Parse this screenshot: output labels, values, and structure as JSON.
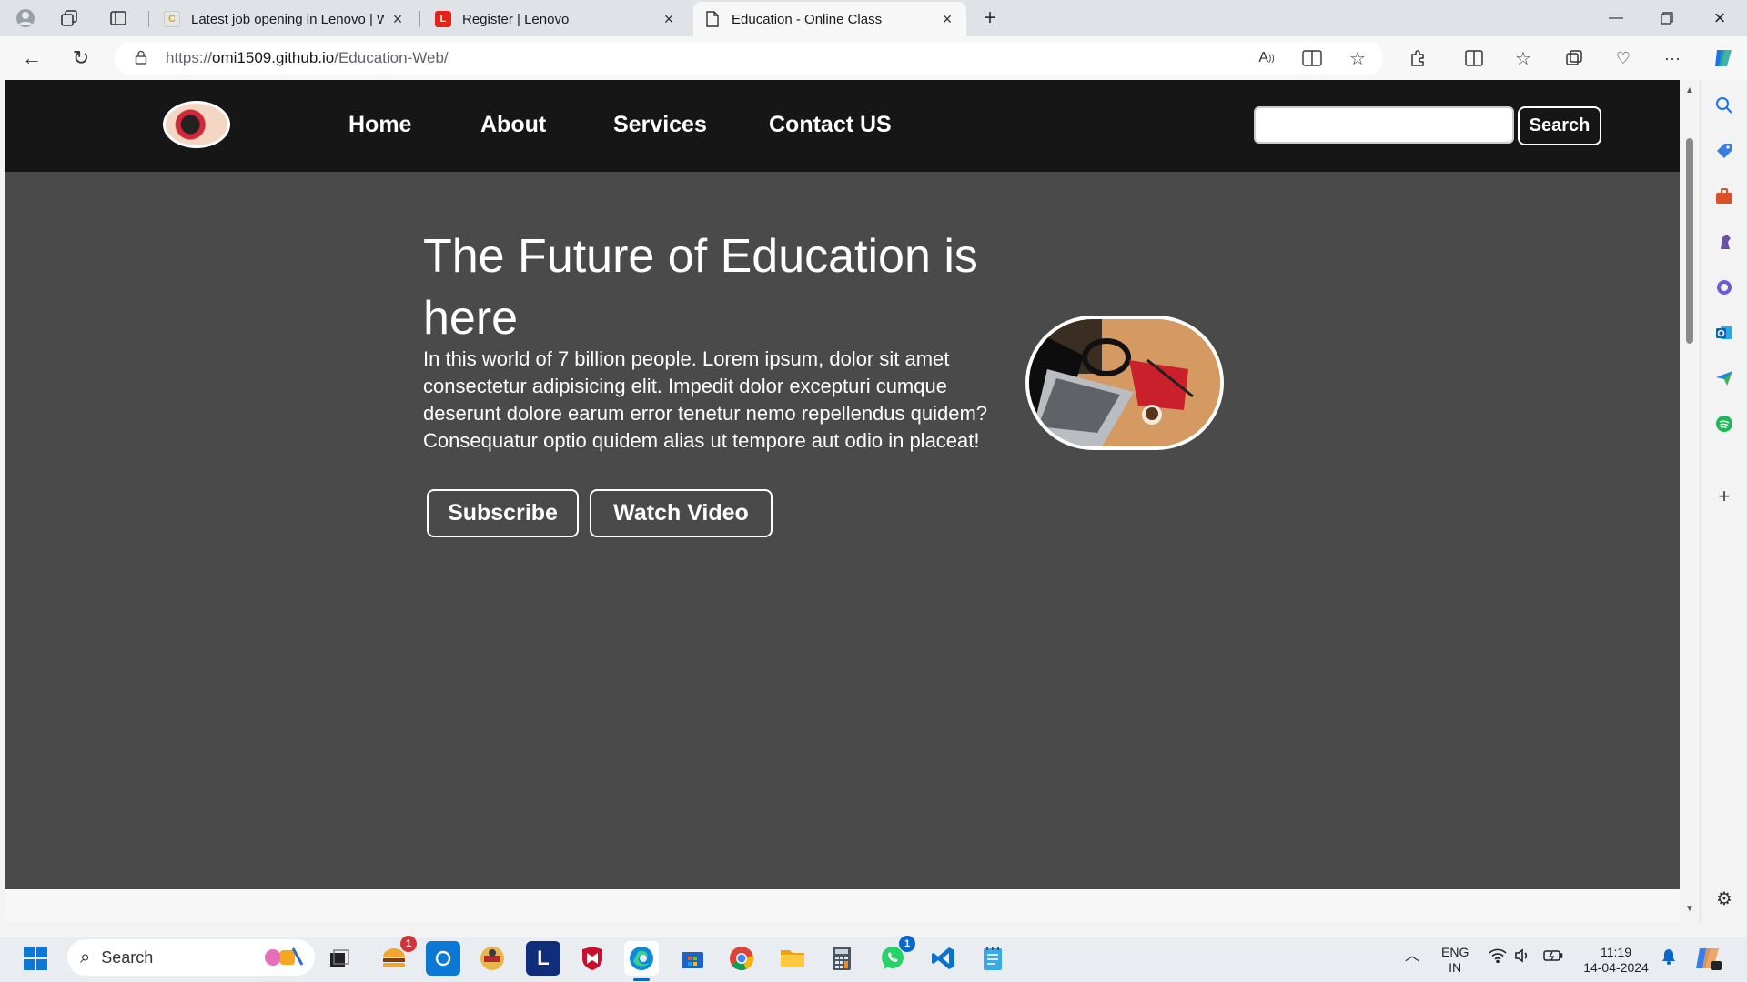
{
  "browser": {
    "tabs": [
      {
        "label": "Latest job opening in Lenovo | W",
        "favicon": "tab-favicon-job-icon",
        "active": false
      },
      {
        "label": "Register | Lenovo",
        "favicon": "tab-favicon-lenovo-icon",
        "active": false
      },
      {
        "label": "Education - Online Class",
        "favicon": "tab-favicon-page-icon",
        "active": true
      }
    ],
    "url_prefix": "https://",
    "url_domain": "omi1509.github.io",
    "url_path": "/Education-Web/"
  },
  "site": {
    "nav": [
      "Home",
      "About",
      "Services",
      "Contact US"
    ],
    "search_button": "Search",
    "search_placeholder": "",
    "hero_title": "The Future of Education is here",
    "hero_text": "In this world of 7 billion people. Lorem ipsum, dolor sit amet consectetur adipisicing elit. Impedit dolor excepturi cumque deserunt dolore earum error tenetur nemo repellendus quidem? Consequatur optio quidem alias ut tempore aut odio in placeat!",
    "buttons": [
      "Subscribe",
      "Watch Video"
    ]
  },
  "taskbar": {
    "search_label": "Search",
    "badges": {
      "app1": "1",
      "whatsapp": "1"
    },
    "app_letter_l": "L",
    "lang": "ENG",
    "region": "IN",
    "time": "11:19",
    "date": "14-04-2024"
  },
  "colors": {
    "site_nav_bg": "#161616",
    "page_bg": "#4a4a4a",
    "accent_edge": "#0a67c7"
  }
}
